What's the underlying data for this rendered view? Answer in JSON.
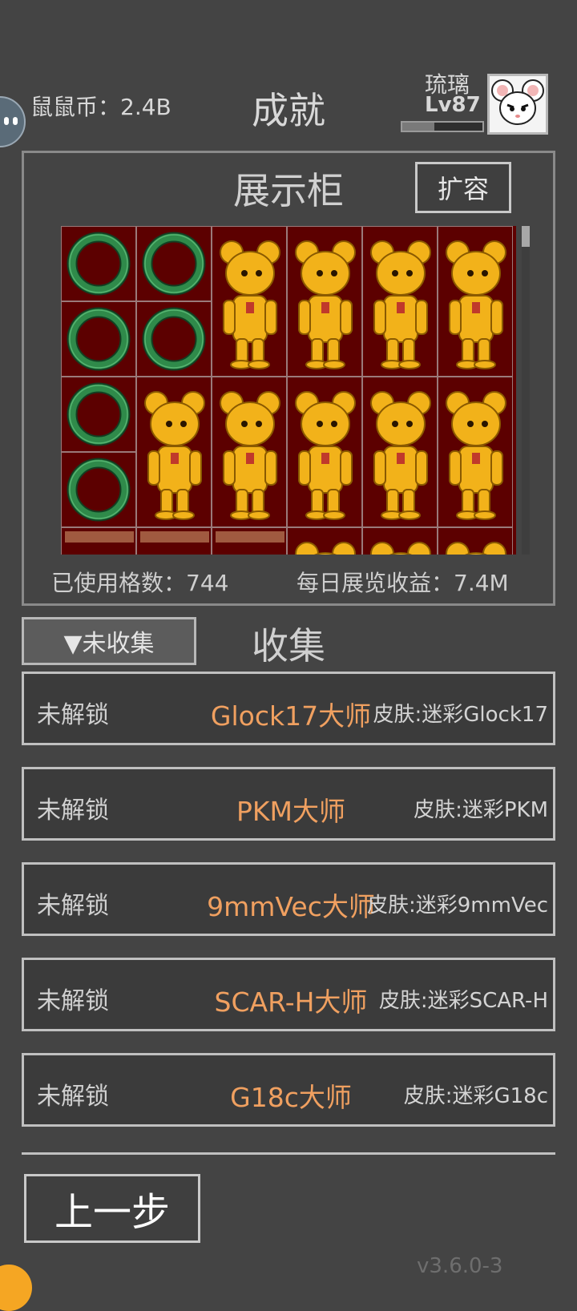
{
  "header": {
    "coins_label": "鼠鼠币：2.4B",
    "title": "成就",
    "user_name": "琉璃",
    "user_level": "Lv87",
    "xp_progress": 0.4
  },
  "cabinet": {
    "title": "展示柜",
    "expand_label": "扩容",
    "used_cells_label": "已使用格数：744",
    "daily_income_label": "每日展览收益：7.4M"
  },
  "collection": {
    "filter_label": "▼未收集",
    "title": "收集",
    "rows": [
      {
        "status": "未解锁",
        "name": "Glock17大师",
        "reward": "皮肤:迷彩Glock17"
      },
      {
        "status": "未解锁",
        "name": "PKM大师",
        "reward": "皮肤:迷彩PKM"
      },
      {
        "status": "未解锁",
        "name": "9mmVec大师",
        "reward": "皮肤:迷彩9mmVec"
      },
      {
        "status": "未解锁",
        "name": "SCAR-H大师",
        "reward": "皮肤:迷彩SCAR-H"
      },
      {
        "status": "未解锁",
        "name": "G18c大师",
        "reward": "皮肤:迷彩G18c"
      }
    ]
  },
  "footer": {
    "back_label": "上一步",
    "version": "v3.6.0-3"
  },
  "colors": {
    "background": "#444444",
    "cabinet_cell": "#5c0000",
    "achievement_name": "#f0a060",
    "jade_ring": "#2f8a4a",
    "gold_bear": "#f2b21a"
  },
  "icons": {
    "assistant": "robot-face-icon",
    "avatar": "white-mouse-avatar",
    "small_item": "jade-ring-icon",
    "large_item": "gold-bear-icon"
  }
}
